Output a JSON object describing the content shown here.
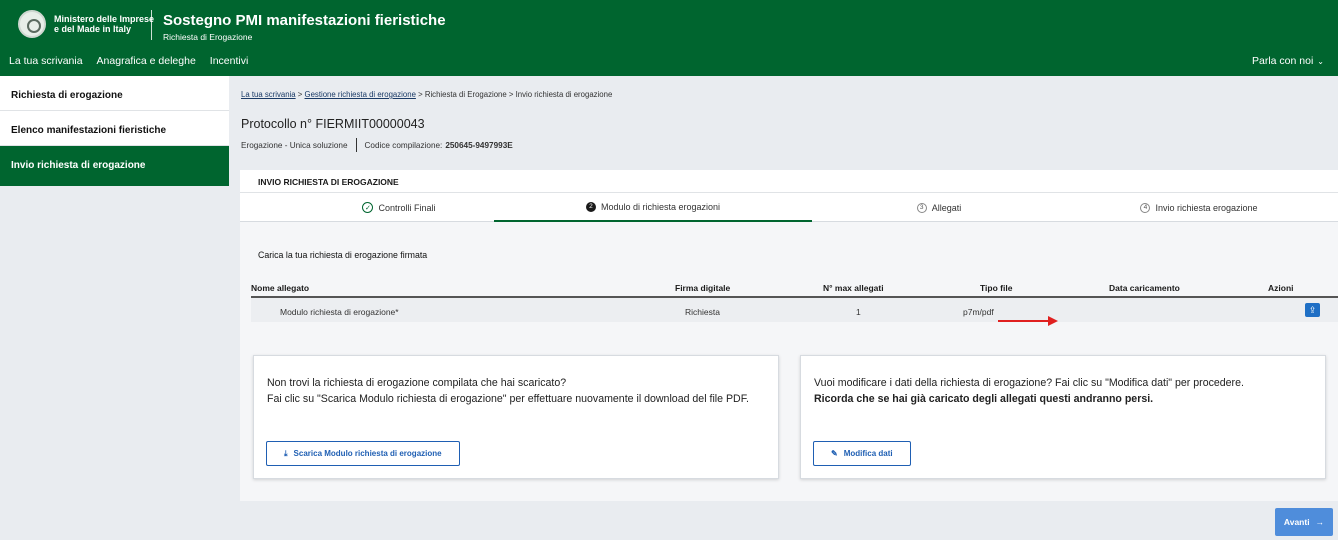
{
  "header": {
    "ministry_line1": "Ministero delle Imprese",
    "ministry_line2": "e del Made in Italy",
    "app_title": "Sostegno PMI manifestazioni fieristiche",
    "app_subtitle": "Richiesta di Erogazione",
    "nav": [
      "La tua scrivania",
      "Anagrafica e deleghe",
      "Incentivi"
    ],
    "contact_label": "Parla con noi",
    "colors": {
      "primary": "#00652f",
      "link": "#1f5fb3",
      "button": "#4f8ddb"
    }
  },
  "sidebar": {
    "items": [
      {
        "label": "Richiesta di erogazione"
      },
      {
        "label": "Elenco manifestazioni fieristiche"
      },
      {
        "label": "Invio richiesta di erogazione"
      }
    ]
  },
  "breadcrumb": {
    "items": [
      "La tua scrivania",
      "Gestione richiesta di erogazione",
      "Richiesta di Erogazione",
      "Invio richiesta di erogazione"
    ],
    "separator": ">"
  },
  "protocol": {
    "title": "Protocollo n° FIERMIIT00000043",
    "type": "Erogazione  -  Unica soluzione",
    "code_label": "Codice compilazione:",
    "code_value": "250645-9497993E"
  },
  "section": {
    "heading": "INVIO RICHIESTA DI EROGAZIONE",
    "tabs": [
      {
        "number": "",
        "label": "Controlli Finali",
        "status": "done"
      },
      {
        "number": "2",
        "label": "Modulo di richiesta erogazioni",
        "status": "active"
      },
      {
        "number": "3",
        "label": "Allegati",
        "status": "pending"
      },
      {
        "number": "4",
        "label": "Invio richiesta erogazione",
        "status": "pending"
      }
    ],
    "upload_title": "Carica la tua richiesta di erogazione firmata"
  },
  "table": {
    "columns": [
      "Nome allegato",
      "Firma digitale",
      "N° max allegati",
      "Tipo file",
      "Data caricamento",
      "Azioni"
    ],
    "rows": [
      {
        "name": "Modulo richiesta di erogazione*",
        "signature": "Richiesta",
        "max": "1",
        "type": "p7m/pdf",
        "date": ""
      }
    ],
    "action_icon": "upload-icon"
  },
  "cards": {
    "download": {
      "line1": "Non trovi la richiesta di erogazione compilata che hai scaricato?",
      "line2": "Fai clic su \"Scarica Modulo richiesta di erogazione\" per effettuare nuovamente il download del file PDF.",
      "button": "Scarica Modulo richiesta di erogazione"
    },
    "edit": {
      "line1": "Vuoi modificare i dati della richiesta di erogazione? Fai clic su \"Modifica dati\" per procedere.",
      "line2": "Ricorda che se hai già caricato degli allegati questi andranno persi.",
      "button": "Modifica dati"
    }
  },
  "footer": {
    "next_label": "Avanti"
  }
}
